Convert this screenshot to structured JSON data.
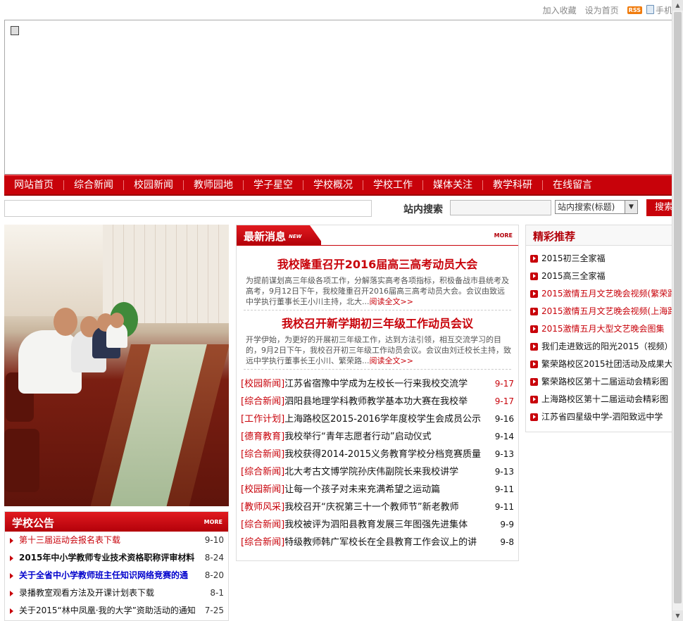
{
  "topbar": {
    "favorite": "加入收藏",
    "homepage": "设为首页",
    "rss": "RSS",
    "mobile": "手机"
  },
  "nav": [
    "网站首页",
    "综合新闻",
    "校园新闻",
    "教师园地",
    "学子星空",
    "学校概况",
    "学校工作",
    "媒体关注",
    "教学科研",
    "在线留言"
  ],
  "search": {
    "label": "站内搜索",
    "option": "站内搜索(标题)",
    "button": "搜索"
  },
  "notice": {
    "title": "学校公告",
    "more": "MORE",
    "items": [
      {
        "text": "第十三届运动会报名表下载",
        "date": "9-10",
        "color": "#c8020a",
        "bold": false
      },
      {
        "text": "2015年中小学教师专业技术资格职称评审材料",
        "date": "8-24",
        "color": "#111111",
        "bold": true
      },
      {
        "text": "关于全省中小学教师班主任知识网络竞赛的通",
        "date": "8-20",
        "color": "#0000cc",
        "bold": true
      },
      {
        "text": "录播教室观看方法及开课计划表下载",
        "date": "8-1",
        "color": "#111111",
        "bold": false
      },
      {
        "text": "关于2015“林中凤凰·我的大学”资助活动的通知",
        "date": "7-25",
        "color": "#111111",
        "bold": false
      }
    ]
  },
  "news": {
    "title": "最新消息",
    "tag": "NEW",
    "more": "MORE",
    "featured": [
      {
        "headline": "我校隆重召开2016届高三高考动员大会",
        "summary": "为提前谋划高三年级各项工作，分解落实高考各项指标，积极备战市县统考及高考，9月12日下午，我校隆重召开2016届高三高考动员大会。会议由致远中学执行董事长王小川主持，北大...",
        "read": "阅读全文>>"
      },
      {
        "headline": "我校召开新学期初三年级工作动员会议",
        "summary": "开学伊始，为更好的开展初三年级工作，达到方法引领，相互交流学习的目的，9月2日下午，我校召开初三年级工作动员会议。会议由刘迁校长主持，致远中学执行董事长王小川、繁荣路...",
        "read": "阅读全文>>"
      }
    ],
    "items": [
      {
        "cat": "[校园新闻]",
        "text": "江苏省宿豫中学成为左校长一行来我校交流学",
        "date": "9-17",
        "datecolor": "#c8020a"
      },
      {
        "cat": "[综合新闻]",
        "text": "泗阳县地理学科教师教学基本功大赛在我校举",
        "date": "9-17",
        "datecolor": "#c8020a"
      },
      {
        "cat": "[工作计划]",
        "text": "上海路校区2015-2016学年度校学生会成员公示",
        "date": "9-16",
        "datecolor": "#111111"
      },
      {
        "cat": "[德育教育]",
        "text": "我校举行“青年志愿者行动”启动仪式",
        "date": "9-14",
        "datecolor": "#111111"
      },
      {
        "cat": "[综合新闻]",
        "text": "我校获得2014-2015义务教育学校分档竞赛质量",
        "date": "9-13",
        "datecolor": "#111111"
      },
      {
        "cat": "[综合新闻]",
        "text": "北大考古文博学院孙庆伟副院长来我校讲学",
        "date": "9-13",
        "datecolor": "#111111"
      },
      {
        "cat": "[校园新闻]",
        "text": "让每一个孩子对未来充满希望之运动篇",
        "date": "9-11",
        "datecolor": "#111111"
      },
      {
        "cat": "[教师风采]",
        "text": "我校召开“庆祝第三十一个教师节”新老教师",
        "date": "9-11",
        "datecolor": "#111111"
      },
      {
        "cat": "[综合新闻]",
        "text": "我校被评为泗阳县教育发展三年图强先进集体",
        "date": "9-9",
        "datecolor": "#111111"
      },
      {
        "cat": "[综合新闻]",
        "text": "特级教师韩广军校长在全县教育工作会议上的讲",
        "date": "9-8",
        "datecolor": "#111111"
      }
    ]
  },
  "hot": {
    "title": "精彩推荐",
    "items": [
      {
        "text": "2015初三全家福",
        "color": "#111111"
      },
      {
        "text": "2015高三全家福",
        "color": "#111111"
      },
      {
        "text": "2015激情五月文艺晚会视频(繁荣路",
        "color": "#c8020a"
      },
      {
        "text": "2015激情五月文艺晚会视频(上海路",
        "color": "#c8020a"
      },
      {
        "text": "2015激情五月大型文艺晚会图集",
        "color": "#c8020a"
      },
      {
        "text": "我们走进致远的阳光2015（视频）",
        "color": "#111111"
      },
      {
        "text": "繁荣路校区2015社团活动及成果大",
        "color": "#111111"
      },
      {
        "text": "繁荣路校区第十二届运动会精彩图",
        "color": "#111111"
      },
      {
        "text": "上海路校区第十二届运动会精彩图",
        "color": "#111111"
      },
      {
        "text": "江苏省四星级中学-泗阳致远中学",
        "color": "#111111"
      }
    ]
  }
}
